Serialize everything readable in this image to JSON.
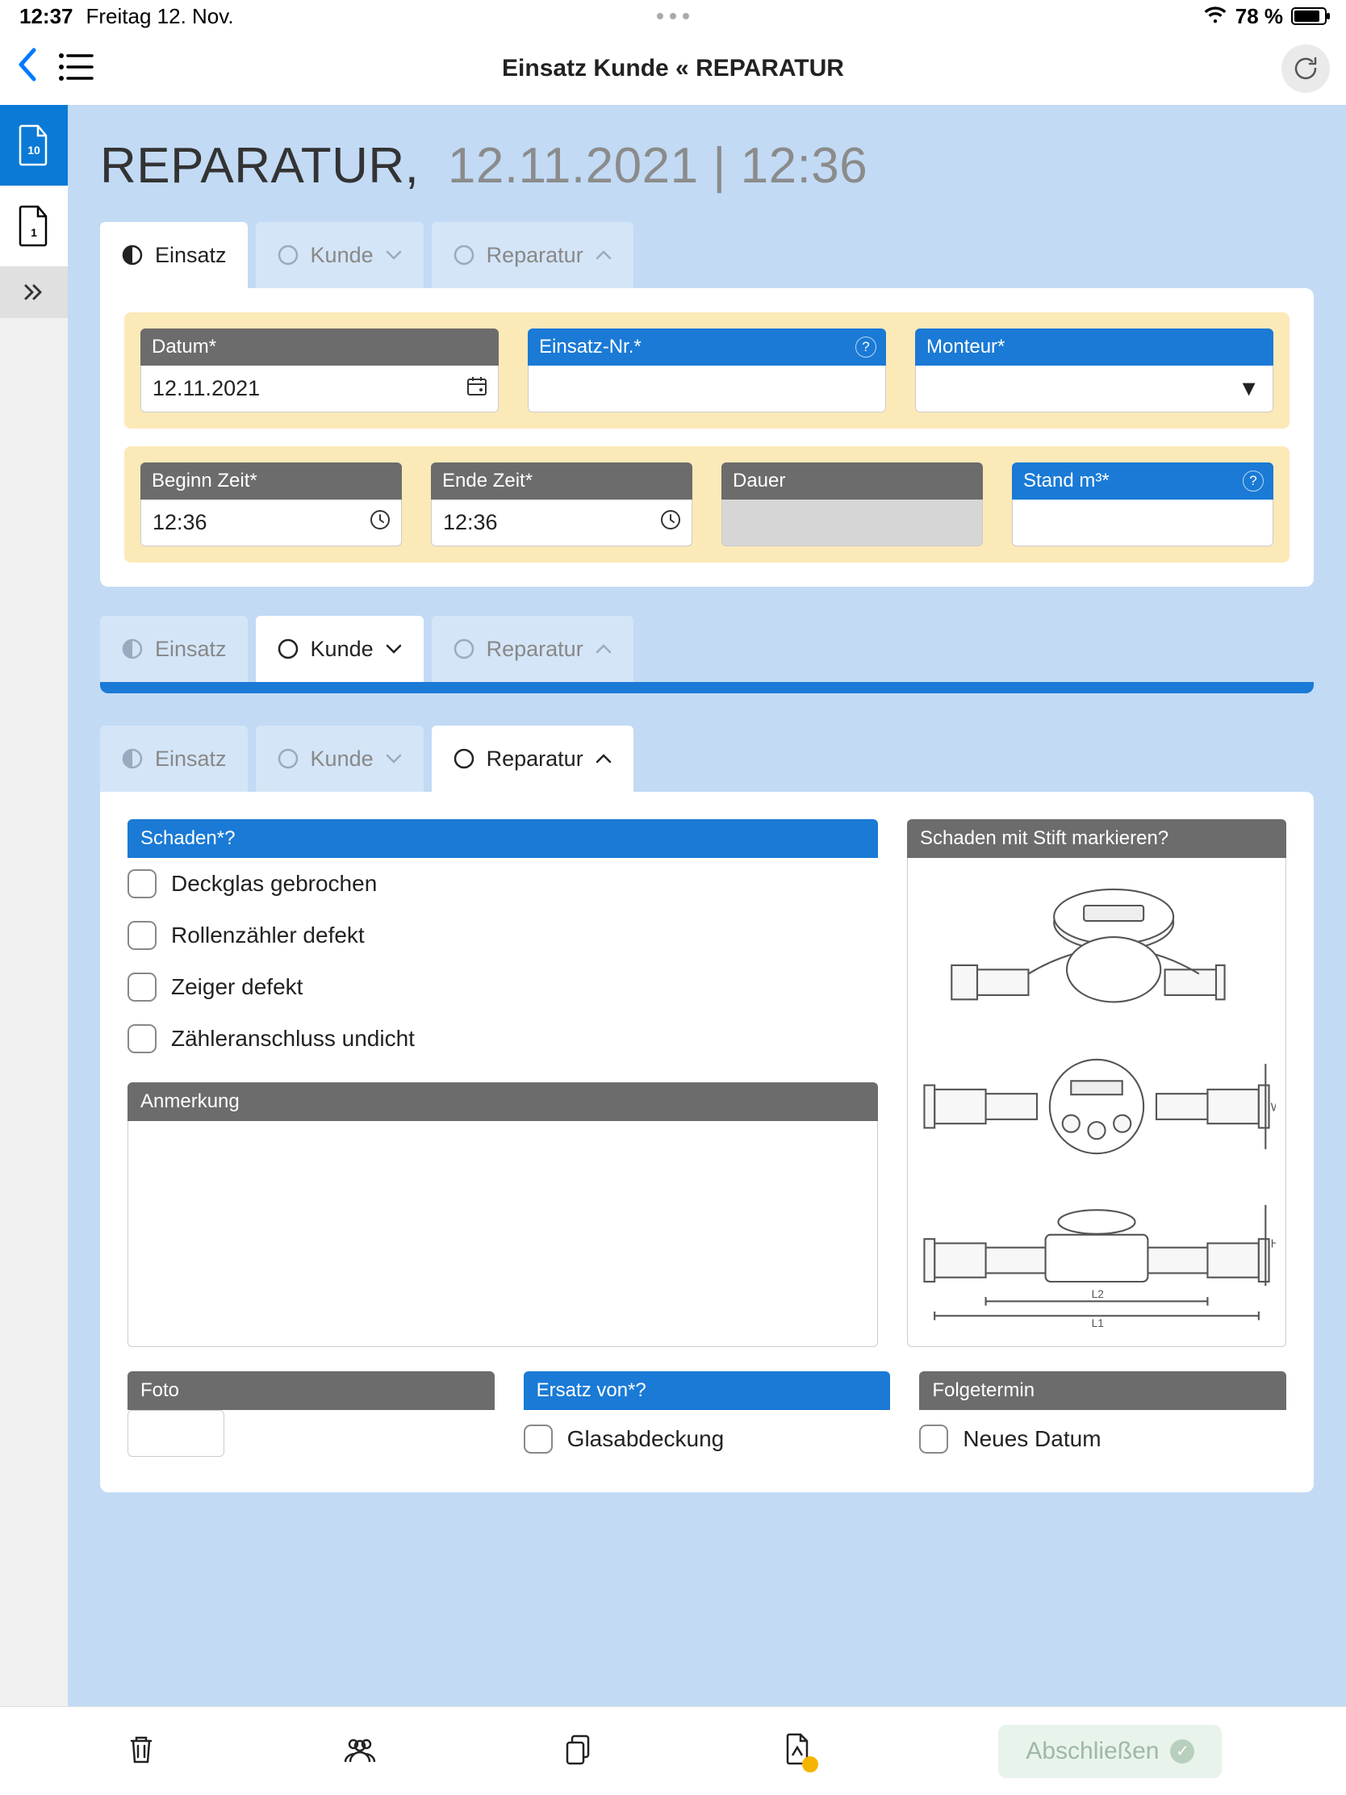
{
  "status": {
    "time": "12:37",
    "date": "Freitag 12. Nov.",
    "battery": "78 %"
  },
  "nav": {
    "title": "Einsatz Kunde  «  REPARATUR"
  },
  "sidebar": {
    "badge1": "10",
    "badge2": "1"
  },
  "page": {
    "title_strong": "REPARATUR,",
    "title_grey": "12.11.2021 | 12:36"
  },
  "tabs": {
    "einsatz": "Einsatz",
    "kunde": "Kunde",
    "reparatur": "Reparatur"
  },
  "einsatz_fields": {
    "datum_label": "Datum*",
    "datum_value": "12.11.2021",
    "nr_label": "Einsatz-Nr.*",
    "nr_value": "",
    "monteur_label": "Monteur*",
    "monteur_value": "",
    "beginn_label": "Beginn Zeit*",
    "beginn_value": "12:36",
    "ende_label": "Ende Zeit*",
    "ende_value": "12:36",
    "dauer_label": "Dauer",
    "dauer_value": "",
    "stand_label": "Stand m³*",
    "stand_value": ""
  },
  "reparatur": {
    "schaden_label": "Schaden*",
    "schaden_items": {
      "0": "Deckglas gebrochen",
      "1": "Rollenzähler defekt",
      "2": "Zeiger defekt",
      "3": "Zähleranschluss undicht"
    },
    "anmerkung_label": "Anmerkung",
    "markieren_label": "Schaden mit Stift markieren",
    "foto_label": "Foto",
    "ersatz_label": "Ersatz von*",
    "ersatz_item0": "Glasabdeckung",
    "folge_label": "Folgetermin",
    "folge_item0": "Neues Datum"
  },
  "bottom": {
    "finish": "Abschließen"
  }
}
